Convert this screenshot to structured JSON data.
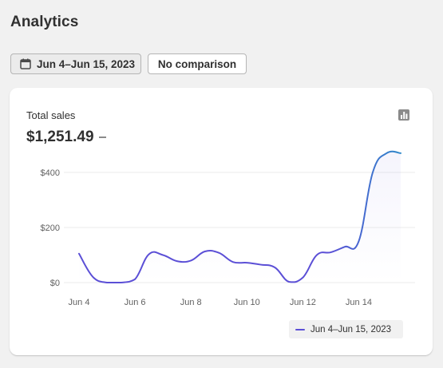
{
  "page": {
    "title": "Analytics"
  },
  "toolbar": {
    "date_range_label": "Jun 4–Jun 15, 2023",
    "date_range_icon": "calendar-icon",
    "comparison_label": "No comparison"
  },
  "card": {
    "metric_label": "Total sales",
    "metric_value": "$1,251.49",
    "chart_type_icon": "bar-chart-icon",
    "legend_label": "Jun 4–Jun 15, 2023"
  },
  "colors": {
    "line_start": "#5b4fd6",
    "line_end": "#2e88c9",
    "axis_text": "#616161",
    "grid": "#ebebeb"
  },
  "chart_data": {
    "type": "line",
    "x": [
      "Jun 4",
      "Jun 4",
      "Jun 5",
      "Jun 5",
      "Jun 6",
      "Jun 6",
      "Jun 7",
      "Jun 7",
      "Jun 8",
      "Jun 8",
      "Jun 9",
      "Jun 9",
      "Jun 10",
      "Jun 10",
      "Jun 11",
      "Jun 11",
      "Jun 12",
      "Jun 12",
      "Jun 13",
      "Jun 13",
      "Jun 14",
      "Jun 14",
      "Jun 15",
      "Jun 15"
    ],
    "x_ticks": [
      "Jun 4",
      "Jun 6",
      "Jun 8",
      "Jun 10",
      "Jun 12",
      "Jun 14"
    ],
    "y_ticks": [
      {
        "value": 0,
        "label": "$0"
      },
      {
        "value": 200,
        "label": "$200"
      },
      {
        "value": 400,
        "label": "$400"
      }
    ],
    "ylim": [
      0,
      470
    ],
    "series": [
      {
        "name": "Jun 4–Jun 15, 2023",
        "values": [
          105,
          20,
          0,
          0,
          12,
          103,
          100,
          78,
          80,
          113,
          108,
          75,
          72,
          65,
          55,
          3,
          18,
          100,
          110,
          130,
          150,
          400,
          470,
          470
        ]
      }
    ],
    "grid": true,
    "legend_position": "bottom-right"
  }
}
